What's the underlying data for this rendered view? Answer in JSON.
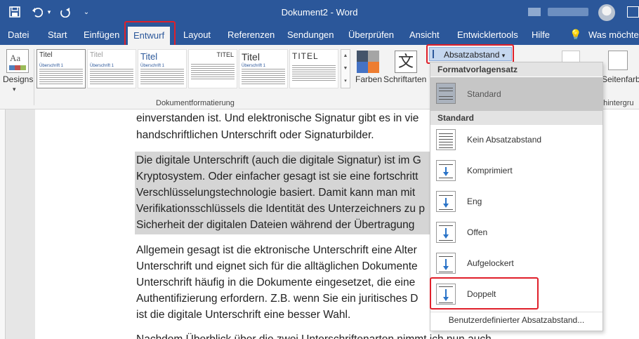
{
  "window": {
    "title": "Dokument2  -  Word"
  },
  "tabs": [
    {
      "label": "Datei"
    },
    {
      "label": "Start"
    },
    {
      "label": "Einfügen"
    },
    {
      "label": "Entwurf"
    },
    {
      "label": "Layout"
    },
    {
      "label": "Referenzen"
    },
    {
      "label": "Sendungen"
    },
    {
      "label": "Überprüfen"
    },
    {
      "label": "Ansicht"
    },
    {
      "label": "Entwicklertools"
    },
    {
      "label": "Hilfe"
    },
    {
      "label": "Was möchten"
    }
  ],
  "ribbon": {
    "designs_label": "Designs",
    "gallery_items": [
      {
        "title": "Titel",
        "sub": "Überschrift 1"
      },
      {
        "title": "Titel",
        "sub": "Überschrift 1"
      },
      {
        "title": "Titel",
        "sub": "Überschrift 1"
      },
      {
        "title": "TITEL",
        "sub": ""
      },
      {
        "title": "Titel",
        "sub": "Überschrift 1"
      },
      {
        "title": "TITEL",
        "sub": ""
      }
    ],
    "group_label": "Dokumentformatierung",
    "farben_label": "Farben",
    "schriftarten_label": "Schriftarten",
    "schriftarten_glyph": "文",
    "absatzabstand_label": "Absatzabstand",
    "seitenfarbe_label": "Seitenfarb",
    "seitenhintergrund_label": "nhintergru"
  },
  "document": {
    "lines": [
      "einverstanden ist. Und elektronische Signatur gibt es in vie",
      "handschriftlichen Unterschrift oder Signaturbilder.",
      "Die digitale Unterschrift (auch die digitale Signatur) ist im G",
      "Kryptosystem. Oder einfacher gesagt ist sie eine fortschritt",
      "Verschlüsselungstechnologie basiert. Damit kann man mit",
      "Verifikationsschlüssels die Identität des Unterzeichners zu p",
      "Sicherheit der digitalen Dateien während der Übertragung",
      "Allgemein gesagt ist die ektronische Unterschrift eine Alter",
      "Unterschrift und eignet sich für die alltäglichen Dokumente",
      "Unterschrift häufig in die Dokumente eingesetzet, die eine",
      "Authentifizierung erfordern. Z.B. wenn Sie ein juritisches D",
      "ist die digitale Unterschrift eine besser Wahl.",
      "Nachdem Überblick über die zwei Unterschriftenarten nimmt ich nun auch"
    ]
  },
  "dropdown": {
    "section1": "Formatvorlagensatz",
    "standard_item": "Standard",
    "section2": "Standard",
    "items": [
      {
        "label": "Kein Absatzabstand"
      },
      {
        "label": "Komprimiert"
      },
      {
        "label": "Eng"
      },
      {
        "label": "Offen"
      },
      {
        "label": "Aufgelockert"
      },
      {
        "label": "Doppelt"
      }
    ],
    "footer": "Benutzerdefinierter Absatzabstand..."
  },
  "colors": {
    "word_blue": "#2b579a",
    "highlight_red": "#e0202a"
  }
}
